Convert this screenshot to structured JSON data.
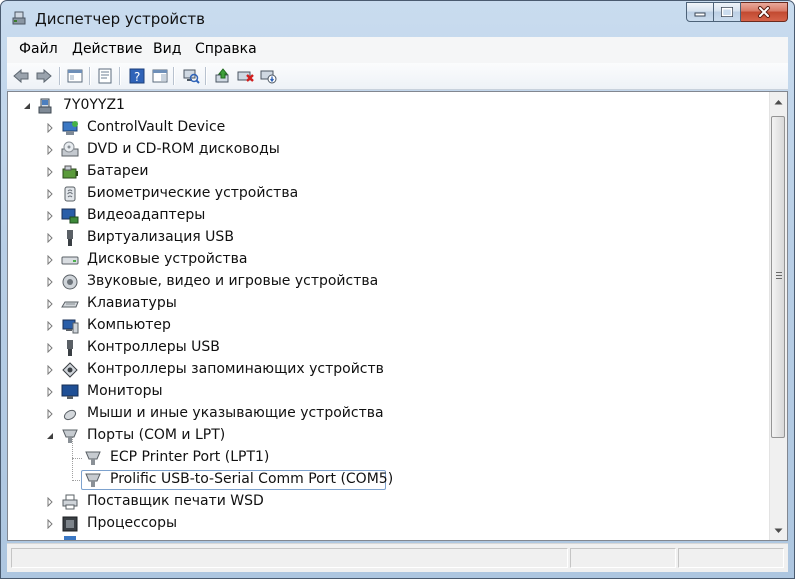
{
  "window": {
    "title": "Диспетчер устройств"
  },
  "menu": {
    "items": [
      "Файл",
      "Действие",
      "Вид",
      "Справка"
    ]
  },
  "toolbar": {
    "buttons": [
      "back-icon",
      "forward-icon",
      "console-tree-icon",
      "properties-icon",
      "help-icon",
      "show-hide-icon",
      "scan-hardware-icon",
      "update-driver-icon",
      "uninstall-icon",
      "disable-icon"
    ]
  },
  "tree": {
    "root": "7Y0YYZ1",
    "categories": [
      "ControlVault Device",
      "DVD и CD-ROM дисководы",
      "Батареи",
      "Биометрические устройства",
      "Видеоадаптеры",
      "Виртуализация USB",
      "Дисковые устройства",
      "Звуковые, видео и игровые устройства",
      "Клавиатуры",
      "Компьютер",
      "Контроллеры USB",
      "Контроллеры запоминающих устройств",
      "Мониторы",
      "Мыши и иные указывающие устройства",
      "Порты (COM и LPT)",
      "Поставщик печати WSD",
      "Процессоры"
    ],
    "ports_children": [
      "ECP Printer Port (LPT1)",
      "Prolific USB-to-Serial Comm Port (COM5)"
    ],
    "selected": "Prolific USB-to-Serial Comm Port (COM5)"
  },
  "colors": {
    "selection_border": "#7da2ce",
    "window_frame": "#b9cfe6",
    "close_button": "#c24a31"
  }
}
